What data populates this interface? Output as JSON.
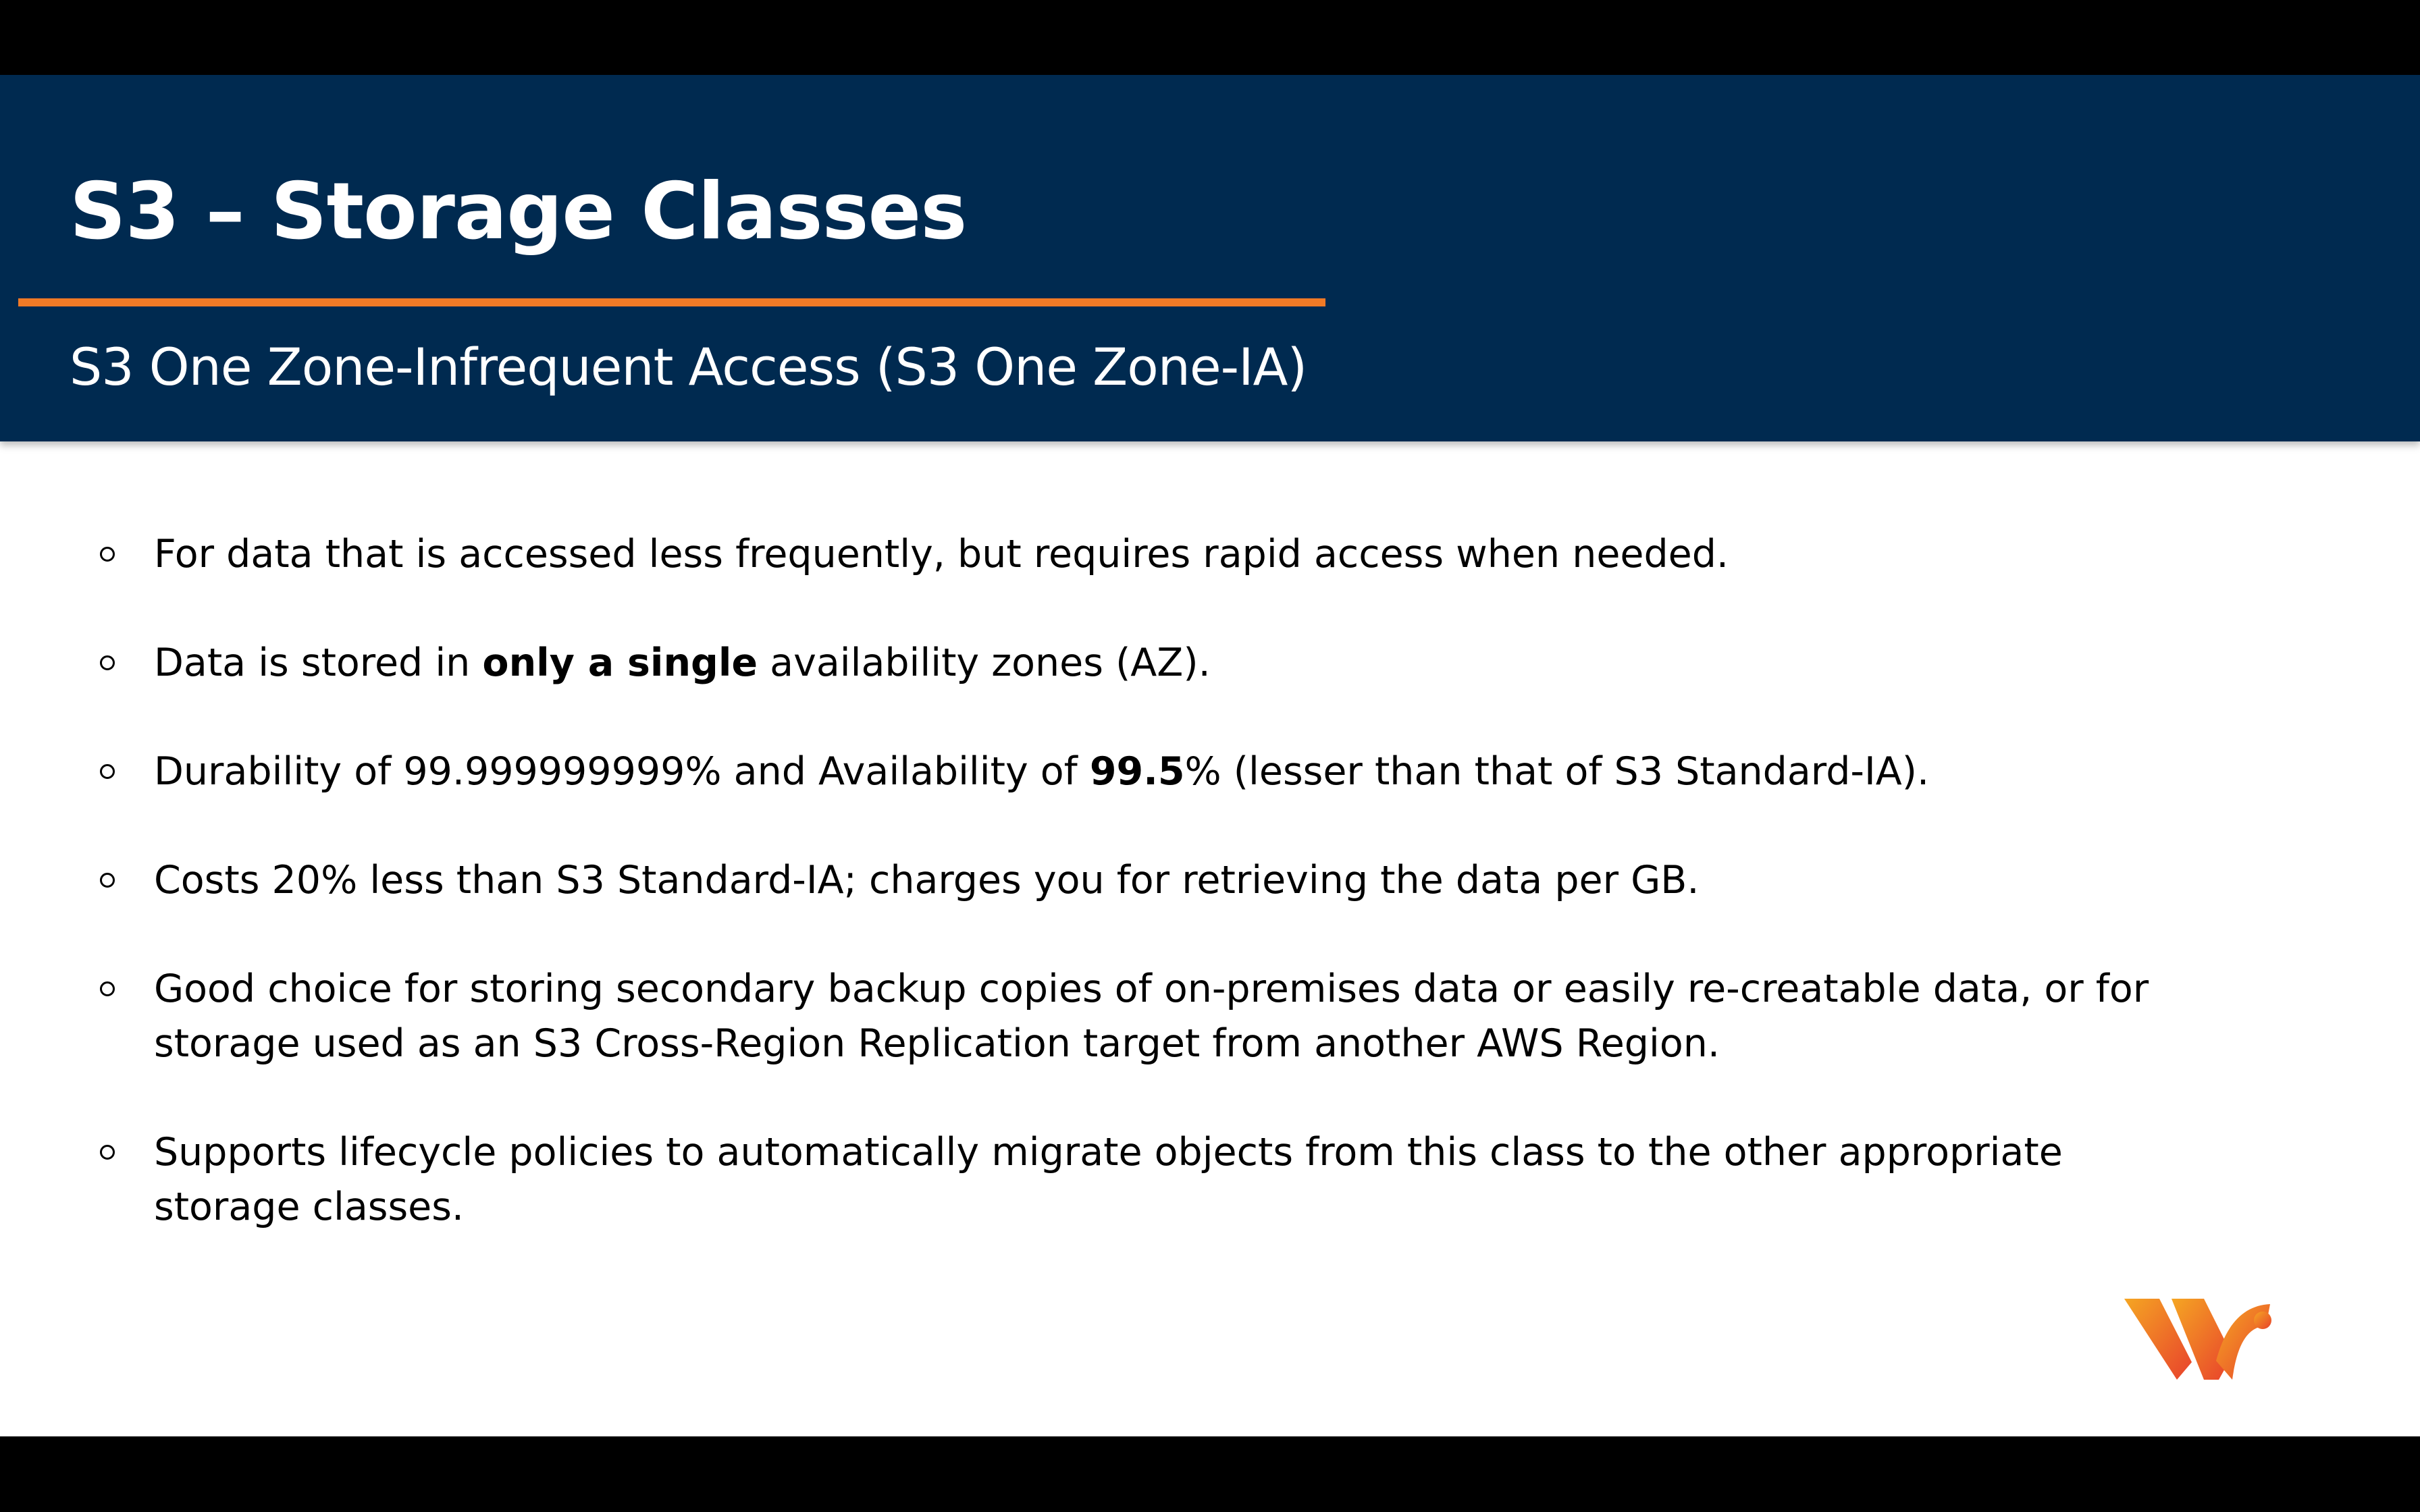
{
  "slide": {
    "title": "S3 – Storage Classes",
    "subtitle": "S3 One Zone-Infrequent Access (S3 One Zone-IA)"
  },
  "bullets": [
    {
      "parts": [
        "For data that is accessed less frequently, but requires rapid access when needed."
      ]
    },
    {
      "parts": [
        "Data is stored in ",
        "only a single",
        " availability zones (AZ)."
      ]
    },
    {
      "parts": [
        "Durability of 99.999999999% and Availability of ",
        "99.5",
        "% (lesser than that of S3 Standard-IA)."
      ]
    },
    {
      "parts": [
        "Costs 20% less than S3 Standard-IA; charges you for retrieving the data per GB."
      ]
    },
    {
      "lines": [
        "Good choice for storing secondary backup copies of on-premises data or easily re-creatable data, or for",
        "storage used as an S3 Cross-Region Replication target from another AWS Region."
      ]
    },
    {
      "lines": [
        "Supports lifecycle policies to automatically migrate objects from this class to the other appropriate",
        "storage classes."
      ]
    }
  ],
  "colors": {
    "header": "#002a50",
    "accent": "#f07a26",
    "logo_start": "#f5a623",
    "logo_end": "#e8412c"
  },
  "logo": {
    "icon": "brand-logo-icon"
  }
}
